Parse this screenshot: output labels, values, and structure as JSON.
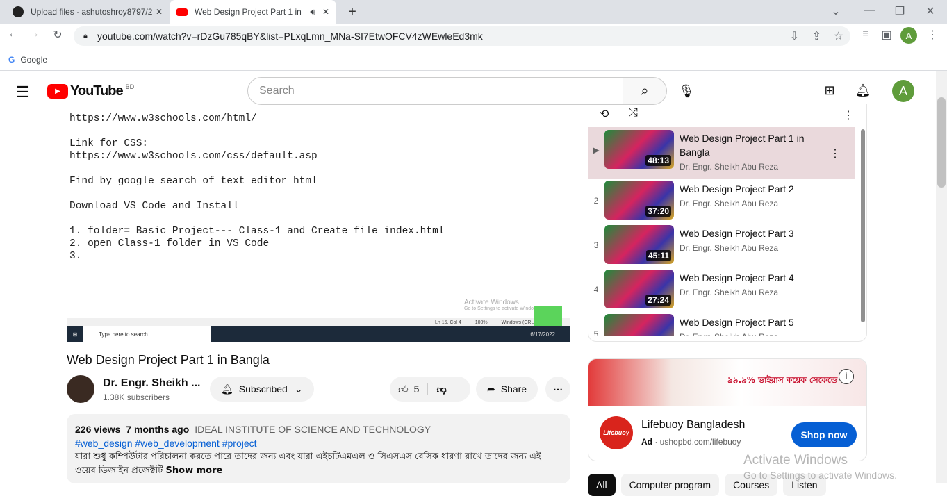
{
  "browser": {
    "tabs": [
      {
        "title": "Upload files · ashutoshroy8797/2"
      },
      {
        "title": "Web Design Project Part 1 in"
      }
    ],
    "url": "youtube.com/watch?v=rDzGu785qBY&list=PLxqLmn_MNa-SI7EtwOFCV4zWEwleEd3mk",
    "bookmark": "Google",
    "profile_initial": "A"
  },
  "yt": {
    "logo": "YouTube",
    "region": "BD",
    "search_placeholder": "Search",
    "avatar": "A"
  },
  "video": {
    "screen_lines": "https://www.w3schools.com/html/\n\nLink for CSS:\nhttps://www.w3schools.com/css/default.asp\n\nFind by google search of text editor html\n\nDownload VS Code and Install\n\n1. folder= Basic Project--- Class-1 and Create file index.html\n2. open Class-1 folder in VS Code\n3.",
    "activate1": "Activate Windows",
    "activate2": "Go to Settings to activate Windows.",
    "status": "Ln 15, Col 4",
    "zoom": "100%",
    "eol": "Windows (CRLF)",
    "taskbar_search": "Type here to search",
    "date": "6/17/2022",
    "title": "Web Design Project Part 1 in Bangla",
    "channel": "Dr. Engr. Sheikh ...",
    "subscribers": "1.38K subscribers",
    "subscribed": "Subscribed",
    "likes": "5",
    "share": "Share",
    "views": "226 views",
    "age": "7 months ago",
    "org": "IDEAL INSTITUTE OF SCIENCE AND TECHNOLOGY",
    "tags": "#web_design #web_development #project",
    "description": "যারা শুধু কম্পিউটার পরিচালনা করতে পারে তাদের জন্য এবং যারা এইচটিএমএল ও সিএসএস বেসিক ধারণা রাখে তাদের জন্য এই ওয়েব ডিজাইন প্রজেক্টটি",
    "show_more": "Show more"
  },
  "playlist": [
    {
      "index": "▶",
      "title": "Web Design Project Part 1 in Bangla",
      "channel": "Dr. Engr. Sheikh Abu Reza",
      "duration": "48:13"
    },
    {
      "index": "2",
      "title": "Web Design Project Part 2",
      "channel": "Dr. Engr. Sheikh Abu Reza",
      "duration": "37:20"
    },
    {
      "index": "3",
      "title": "Web Design Project Part 3",
      "channel": "Dr. Engr. Sheikh Abu Reza",
      "duration": "45:11"
    },
    {
      "index": "4",
      "title": "Web Design Project Part 4",
      "channel": "Dr. Engr. Sheikh Abu Reza",
      "duration": "27:24"
    },
    {
      "index": "5",
      "title": "Web Design Project Part 5",
      "channel": "Dr. Engr. Sheikh Abu Reza",
      "duration": ""
    }
  ],
  "ad": {
    "banner_text": "৯৯.৯% ভাইরাস কয়েক সেকেন্ডে",
    "name": "Lifebuoy Bangladesh",
    "label": "Ad",
    "url": "ushopbd.com/lifebuoy",
    "cta": "Shop now",
    "logo": "Lifebuoy"
  },
  "chips": [
    "All",
    "Computer program",
    "Courses",
    "Listen"
  ],
  "watermark": {
    "line1": "Activate Windows",
    "line2": "Go to Settings to activate Windows."
  }
}
